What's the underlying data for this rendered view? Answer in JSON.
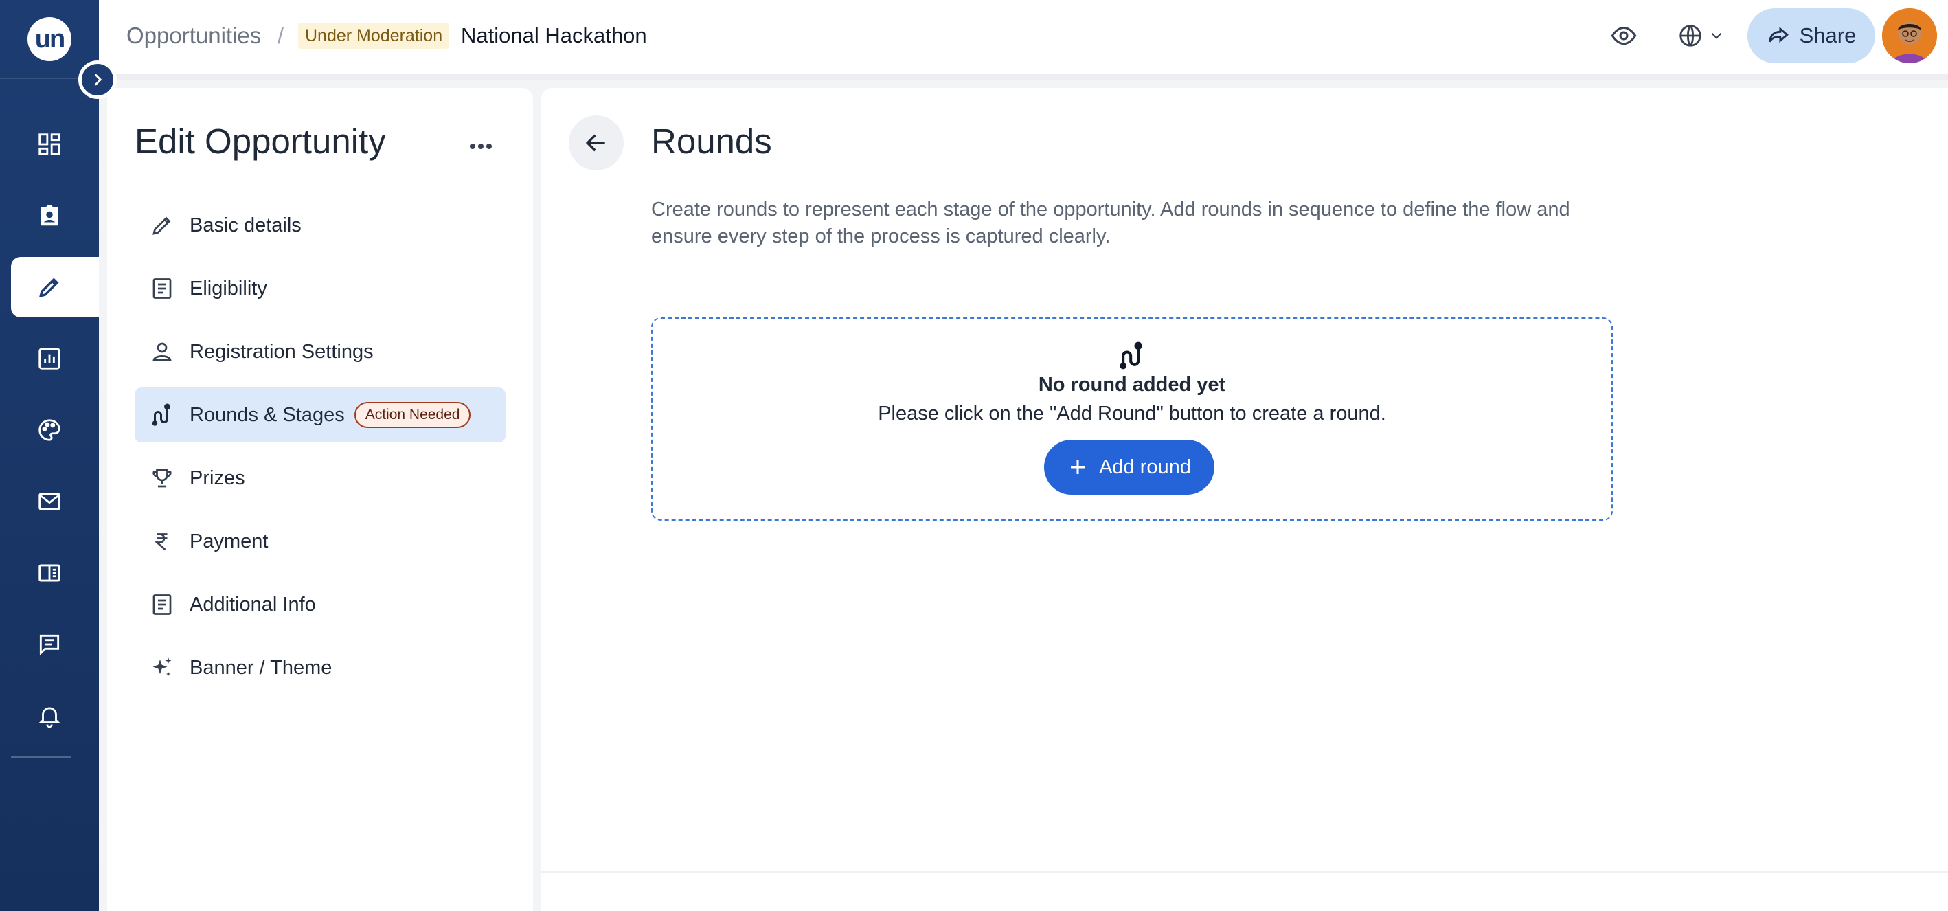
{
  "brand": {
    "logo_text": "un"
  },
  "header": {
    "breadcrumb_root": "Opportunities",
    "breadcrumb_separator": "/",
    "status": "Under Moderation",
    "title": "National Hackathon",
    "share_label": "Share"
  },
  "rail": {
    "items": [
      {
        "icon": "dashboard-icon"
      },
      {
        "icon": "badge-icon"
      },
      {
        "icon": "pencil-icon",
        "active": true
      },
      {
        "icon": "analytics-icon"
      },
      {
        "icon": "palette-icon"
      },
      {
        "icon": "mail-icon"
      },
      {
        "icon": "book-icon"
      },
      {
        "icon": "chat-icon"
      },
      {
        "icon": "bell-icon"
      }
    ]
  },
  "edit_panel": {
    "title": "Edit Opportunity",
    "items": [
      {
        "label": "Basic details",
        "icon": "pencil-icon"
      },
      {
        "label": "Eligibility",
        "icon": "document-icon"
      },
      {
        "label": "Registration Settings",
        "icon": "person-icon"
      },
      {
        "label": "Rounds & Stages",
        "icon": "route-icon",
        "badge": "Action Needed",
        "active": true
      },
      {
        "label": "Prizes",
        "icon": "trophy-icon"
      },
      {
        "label": "Payment",
        "icon": "rupee-icon"
      },
      {
        "label": "Additional Info",
        "icon": "document-icon"
      },
      {
        "label": "Banner / Theme",
        "icon": "sparkle-icon"
      }
    ]
  },
  "main": {
    "title": "Rounds",
    "description": "Create rounds to represent each stage of the opportunity. Add rounds in sequence to define the flow and ensure every step of the process is captured clearly.",
    "empty_title": "No round added yet",
    "empty_subtitle": "Please click on the \"Add Round\" button to create a round.",
    "add_button_label": "Add round"
  },
  "colors": {
    "rail_bg": "#1d3d72",
    "primary": "#2563d9",
    "share_bg": "#c9def7",
    "active_nav_bg": "#dce9fb",
    "badge_border": "#a23b1e",
    "status_bg": "#fcf3d9"
  }
}
